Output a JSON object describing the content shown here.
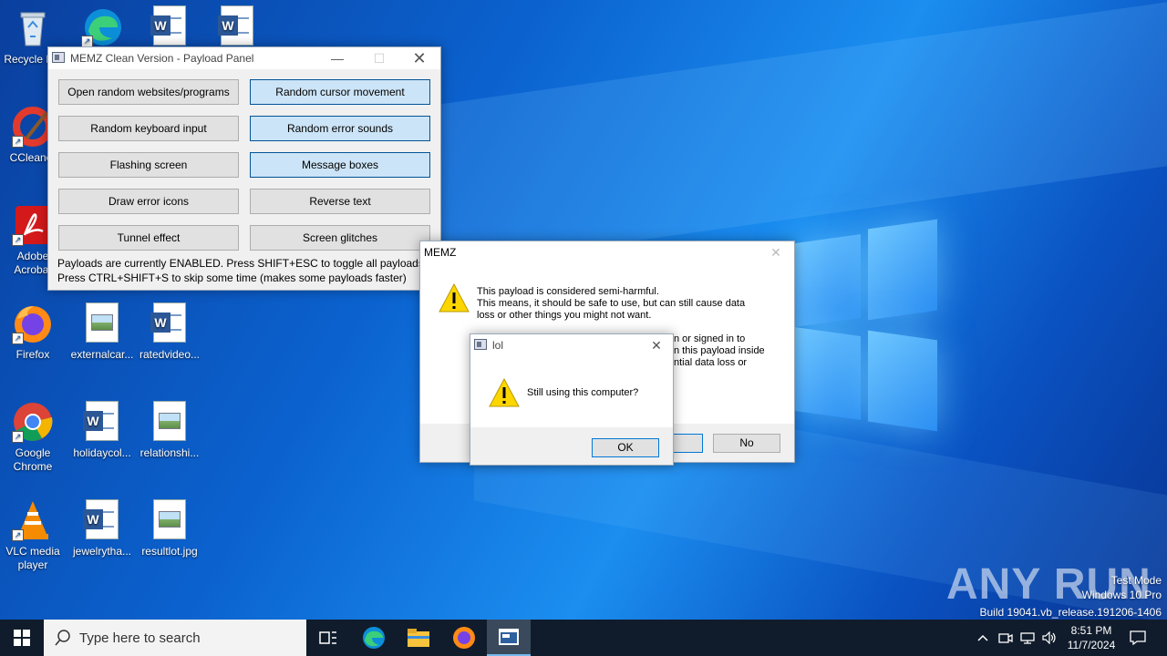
{
  "desktop_icons": [
    {
      "label": "Recycle Bin",
      "icon": "recycle-bin-icon"
    },
    {
      "label": "CCleaner",
      "icon": "ccleaner-icon"
    },
    {
      "label": "Adobe Acrobat",
      "icon": "adobe-acrobat-icon"
    },
    {
      "label": "Firefox",
      "icon": "firefox-icon"
    },
    {
      "label": "Google Chrome",
      "icon": "chrome-icon"
    },
    {
      "label": "VLC media player",
      "icon": "vlc-icon"
    },
    {
      "label": "externalcar...",
      "icon": "image-file-icon"
    },
    {
      "label": "holidaycol...",
      "icon": "word-file-icon"
    },
    {
      "label": "jewelrytha...",
      "icon": "word-file-icon"
    },
    {
      "label": "ratedvideo...",
      "icon": "word-file-icon"
    },
    {
      "label": "relationshi...",
      "icon": "image-file-icon"
    },
    {
      "label": "resultlot.jpg",
      "icon": "image-file-icon"
    }
  ],
  "payload_panel": {
    "title": "MEMZ Clean Version - Payload Panel",
    "buttons": [
      {
        "label": "Open random websites/programs",
        "active": false
      },
      {
        "label": "Random cursor movement",
        "active": true
      },
      {
        "label": "Random keyboard input",
        "active": false
      },
      {
        "label": "Random error sounds",
        "active": true
      },
      {
        "label": "Flashing screen",
        "active": false
      },
      {
        "label": "Message boxes",
        "active": true
      },
      {
        "label": "Draw error icons",
        "active": false
      },
      {
        "label": "Reverse text",
        "active": false
      },
      {
        "label": "Tunnel effect",
        "active": false
      },
      {
        "label": "Screen glitches",
        "active": false
      }
    ],
    "status_line1": "Payloads are currently ENABLED. Press SHIFT+ESC to toggle all payloads!",
    "status_line2": "Press CTRL+SHIFT+S to skip some time (makes some payloads faster)"
  },
  "memz_dialog": {
    "title": "MEMZ",
    "line1": "This payload is considered semi-harmful.",
    "line2": "This means, it should be safe to use, but can still cause data",
    "line3": "loss or other things you might not want.",
    "line4": "n or signed in to",
    "line5": "n this payload inside",
    "line6": "ntial data loss or",
    "yes_label": "s",
    "no_label": "No"
  },
  "lol_dialog": {
    "title": "lol",
    "message": "Still using this computer?",
    "ok_label": "OK"
  },
  "taskbar": {
    "search_placeholder": "Type here to search",
    "time": "8:51 PM",
    "date": "11/7/2024"
  },
  "watermark": {
    "brand": "ANY RUN",
    "line1": "Test Mode",
    "line2": "Windows 10 Pro",
    "line3": "Build 19041.vb_release.191206-1406"
  }
}
